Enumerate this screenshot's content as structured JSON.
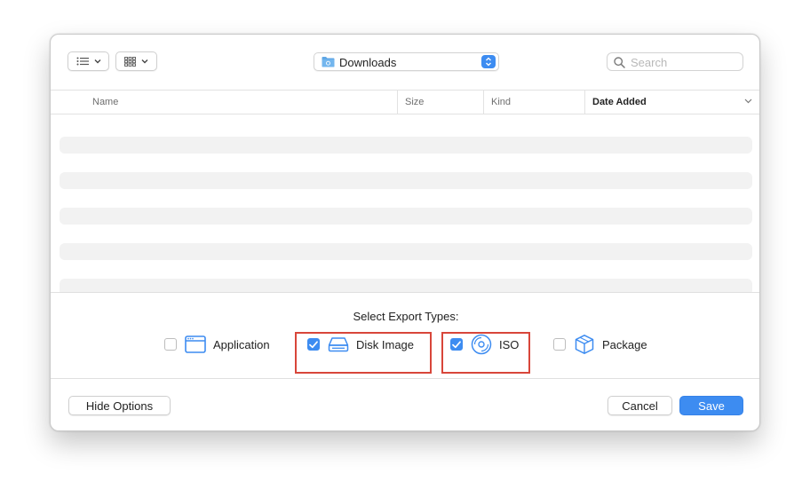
{
  "toolbar": {
    "list_view_icon": "list-icon",
    "grid_view_icon": "grid-icon",
    "location": {
      "label": "Downloads",
      "icon": "folder-icon"
    },
    "search": {
      "placeholder": "Search",
      "value": ""
    }
  },
  "columns": [
    {
      "label": "Name"
    },
    {
      "label": "Size"
    },
    {
      "label": "Kind"
    },
    {
      "label": "Date Added",
      "sorted": true
    }
  ],
  "export_options": {
    "title": "Select Export Types:",
    "types": [
      {
        "label": "Application",
        "checked": false,
        "icon": "application-window-icon"
      },
      {
        "label": "Disk Image",
        "checked": true,
        "icon": "disk-image-icon",
        "highlighted": true
      },
      {
        "label": "ISO",
        "checked": true,
        "icon": "iso-disc-icon",
        "highlighted": true
      },
      {
        "label": "Package",
        "checked": false,
        "icon": "package-box-icon"
      }
    ]
  },
  "footer": {
    "hide_options_label": "Hide Options",
    "cancel_label": "Cancel",
    "save_label": "Save"
  },
  "colors": {
    "accent": "#3d8cf1",
    "highlight_border": "#d8463a"
  }
}
